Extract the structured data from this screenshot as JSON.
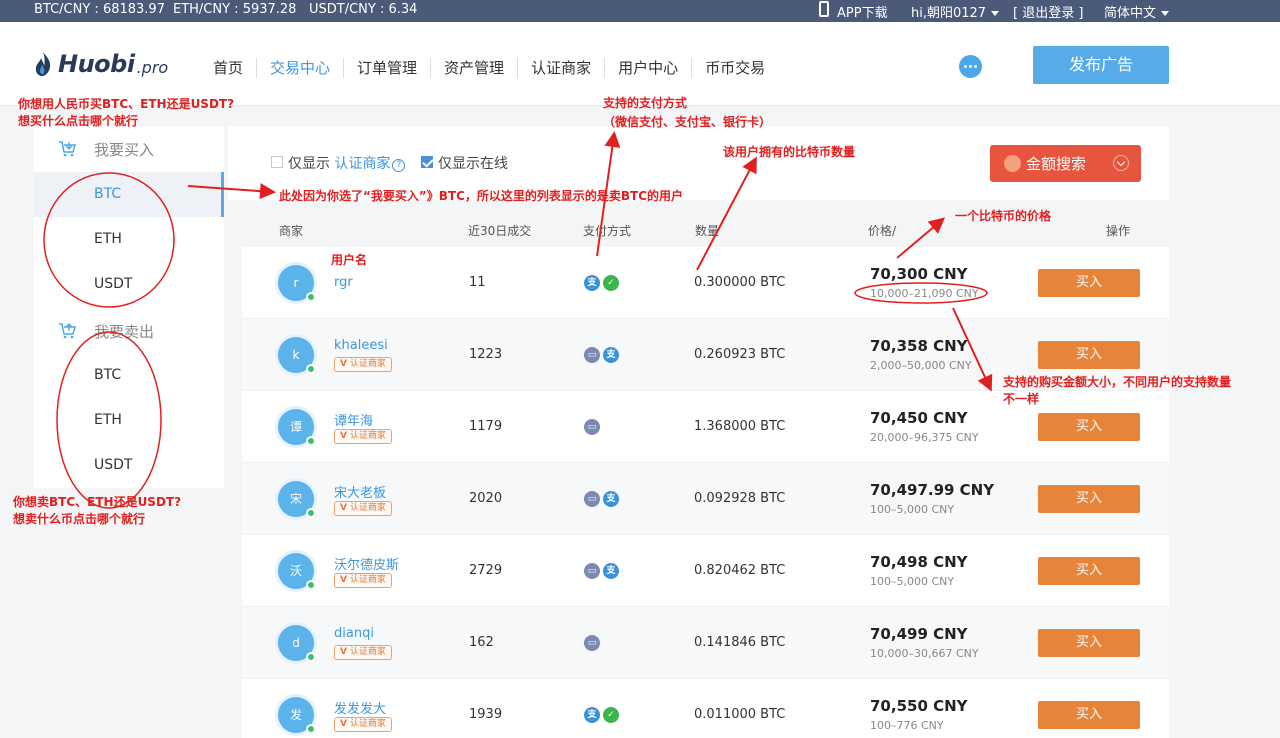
{
  "topbar": {
    "tickers": [
      "BTC/CNY : 68183.97",
      "ETH/CNY : 5937.28",
      "USDT/CNY : 6.34"
    ],
    "app_download": "APP下载",
    "user": "hi,朝阳0127",
    "logout": "[ 退出登录 ]",
    "language": "简体中文"
  },
  "header": {
    "brand": "Huobi",
    "brand_suffix": ".pro",
    "nav": [
      "首页",
      "交易中心",
      "订单管理",
      "资产管理",
      "认证商家",
      "用户中心",
      "币币交易"
    ],
    "active_nav": "交易中心",
    "publish_label": "发布广告"
  },
  "sidebar": {
    "buy_heading": "我要买入",
    "buy_items": [
      "BTC",
      "ETH",
      "USDT"
    ],
    "sell_heading": "我要卖出",
    "sell_items": [
      "BTC",
      "ETH",
      "USDT"
    ],
    "active": "BTC"
  },
  "filter": {
    "show_prefix": "仅显示",
    "certified_link": "认证商家",
    "certified_checked": false,
    "online_label": "仅显示在线",
    "online_checked": true,
    "amount_search": "金额搜索"
  },
  "table": {
    "headers": [
      "商家",
      "近30日成交",
      "支付方式",
      "数量",
      "价格/",
      "操作"
    ],
    "buy_label": "买入",
    "cert_label": "认证商家",
    "rows": [
      {
        "avatar": "r",
        "name": "rgr",
        "certified": false,
        "trades": "11",
        "payments": [
          "alipay",
          "wechat"
        ],
        "amount": "0.300000 BTC",
        "price": "70,300 CNY",
        "limit": "10,000–21,090 CNY"
      },
      {
        "avatar": "k",
        "name": "khaleesi",
        "certified": true,
        "trades": "1223",
        "payments": [
          "bank",
          "alipay"
        ],
        "amount": "0.260923 BTC",
        "price": "70,358 CNY",
        "limit": "2,000–50,000 CNY"
      },
      {
        "avatar": "谭",
        "name": "谭年海",
        "certified": true,
        "trades": "1179",
        "payments": [
          "bank"
        ],
        "amount": "1.368000 BTC",
        "price": "70,450 CNY",
        "limit": "20,000–96,375 CNY"
      },
      {
        "avatar": "宋",
        "name": "宋大老板",
        "certified": true,
        "trades": "2020",
        "payments": [
          "bank",
          "alipay"
        ],
        "amount": "0.092928 BTC",
        "price": "70,497.99 CNY",
        "limit": "100–5,000 CNY"
      },
      {
        "avatar": "沃",
        "name": "沃尔德皮斯",
        "certified": true,
        "trades": "2729",
        "payments": [
          "bank",
          "alipay"
        ],
        "amount": "0.820462 BTC",
        "price": "70,498 CNY",
        "limit": "100–5,000 CNY"
      },
      {
        "avatar": "d",
        "name": "dianqi",
        "certified": true,
        "trades": "162",
        "payments": [
          "bank"
        ],
        "amount": "0.141846 BTC",
        "price": "70,499 CNY",
        "limit": "10,000–30,667 CNY"
      },
      {
        "avatar": "发",
        "name": "发发发大",
        "certified": true,
        "trades": "1939",
        "payments": [
          "alipay",
          "wechat"
        ],
        "amount": "0.011000 BTC",
        "price": "70,550 CNY",
        "limit": "100–776 CNY"
      }
    ]
  },
  "annotations": {
    "buy_question_1": "你想用人民币买BTC、ETH还是USDT?",
    "buy_question_2": "想买什么点击哪个就行",
    "list_note": "此处因为你选了“我要买入”》BTC，所以这里的列表显示的是卖BTC的用户",
    "pay_note_1": "支持的支付方式",
    "pay_note_2": "（微信支付、支付宝、银行卡）",
    "amount_note": "该用户拥有的比特币数量",
    "price_note": "一个比特币的价格",
    "username_note": "用户名",
    "limit_note_1": "支持的购买金额大小，不同用户的支持数量",
    "limit_note_2": "不一样",
    "sell_question_1": "你想卖BTC、ETH还是USDT?",
    "sell_question_2": "想卖什么币点击哪个就行"
  }
}
